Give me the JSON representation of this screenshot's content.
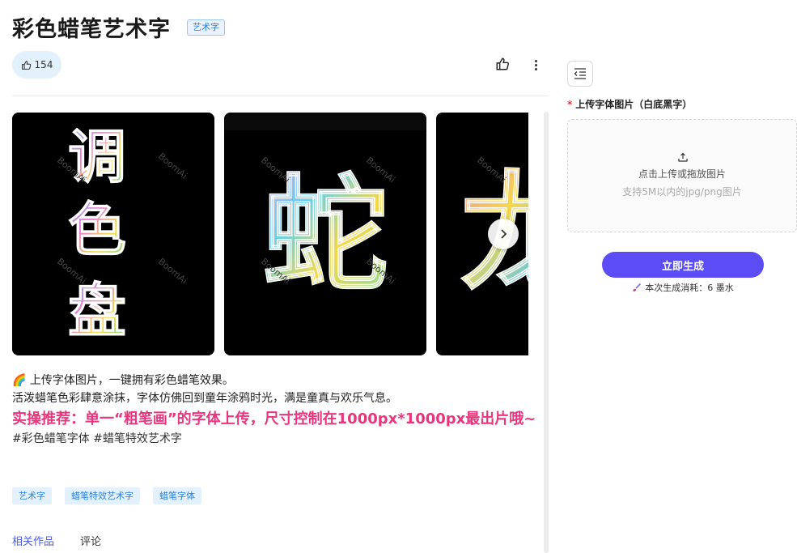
{
  "header": {
    "title": "彩色蜡笔艺术字",
    "badge": "艺术字"
  },
  "actions": {
    "like_count": "154",
    "like_icon": "thumbs-up-icon",
    "more_icon": "more-vertical-icon"
  },
  "carousel": {
    "items": [
      {
        "label": "调色盘",
        "watermark": "BoomAi"
      },
      {
        "label": "蛇",
        "watermark": "BoomAi"
      },
      {
        "label": "龙",
        "watermark": "BoomAi"
      }
    ],
    "next_icon": "chevron-right-icon"
  },
  "description": {
    "line1_emoji": "🌈",
    "line1": "上传字体图片，一键拥有彩色蜡笔效果。",
    "line2": "活泼蜡笔色彩肆意涂抹，字体仿佛回到童年涂鸦时光，满是童真与欢乐气息。",
    "emphasis": "实操推荐：单一“粗笔画”的字体上传，尺寸控制在1000px*1000px最出片哦~",
    "hashtags": "#彩色蜡笔字体 #蜡笔特效艺术字"
  },
  "tags": [
    "艺术字",
    "蜡笔特效艺术字",
    "蜡笔字体"
  ],
  "tabs": {
    "related": "相关作品",
    "comments": "评论"
  },
  "panel": {
    "collapse_icon": "indent-icon",
    "required_mark": "*",
    "upload_label": "上传字体图片（白底黑字）",
    "upload_primary": "点击上传或拖放图片",
    "upload_secondary": "支持5M以内的jpg/png图片",
    "upload_icon": "upload-icon",
    "generate_label": "立即生成",
    "cost_text": "本次生成消耗：6 墨水",
    "cost_icon": "brush-icon"
  },
  "colors": {
    "accent": "#5b4cf5",
    "emphasis": "#e8367e",
    "tag_bg": "#e3f1fd",
    "tag_text": "#2d7fd8"
  }
}
